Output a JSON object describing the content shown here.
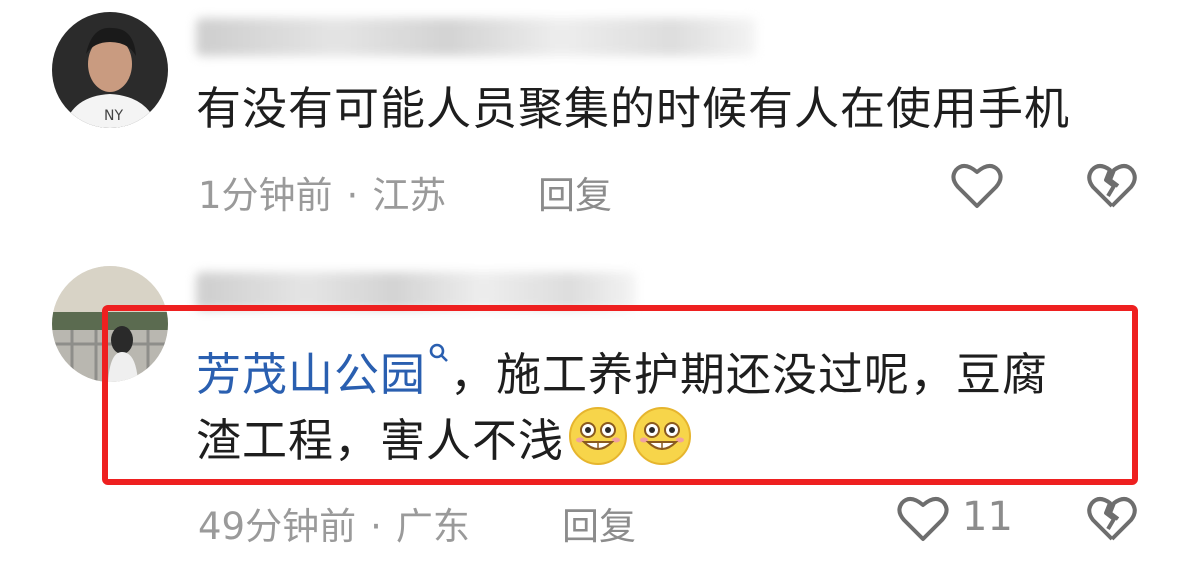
{
  "comments": [
    {
      "username": "",
      "text": "有没有可能人员聚集的时候有人在使用手机",
      "time": "1分钟前",
      "location": "江苏",
      "reply_label": "回复",
      "like_count": ""
    },
    {
      "username": "",
      "topic_link": "芳茂山公园",
      "text_after_topic": "，施工养护期还没过呢，豆腐",
      "text_line2": "渣工程，害人不浅",
      "time": "49分钟前",
      "location": "广东",
      "reply_label": "回复",
      "like_count": "11"
    }
  ],
  "icons": {
    "like": "heart-outline-icon",
    "dislike": "broken-heart-icon",
    "search": "search-icon",
    "emoji": "grinning-emoji-icon"
  },
  "colors": {
    "highlight_border": "#ee2020",
    "topic_link": "#2a5fb0",
    "meta_text": "#9a9a9a"
  }
}
